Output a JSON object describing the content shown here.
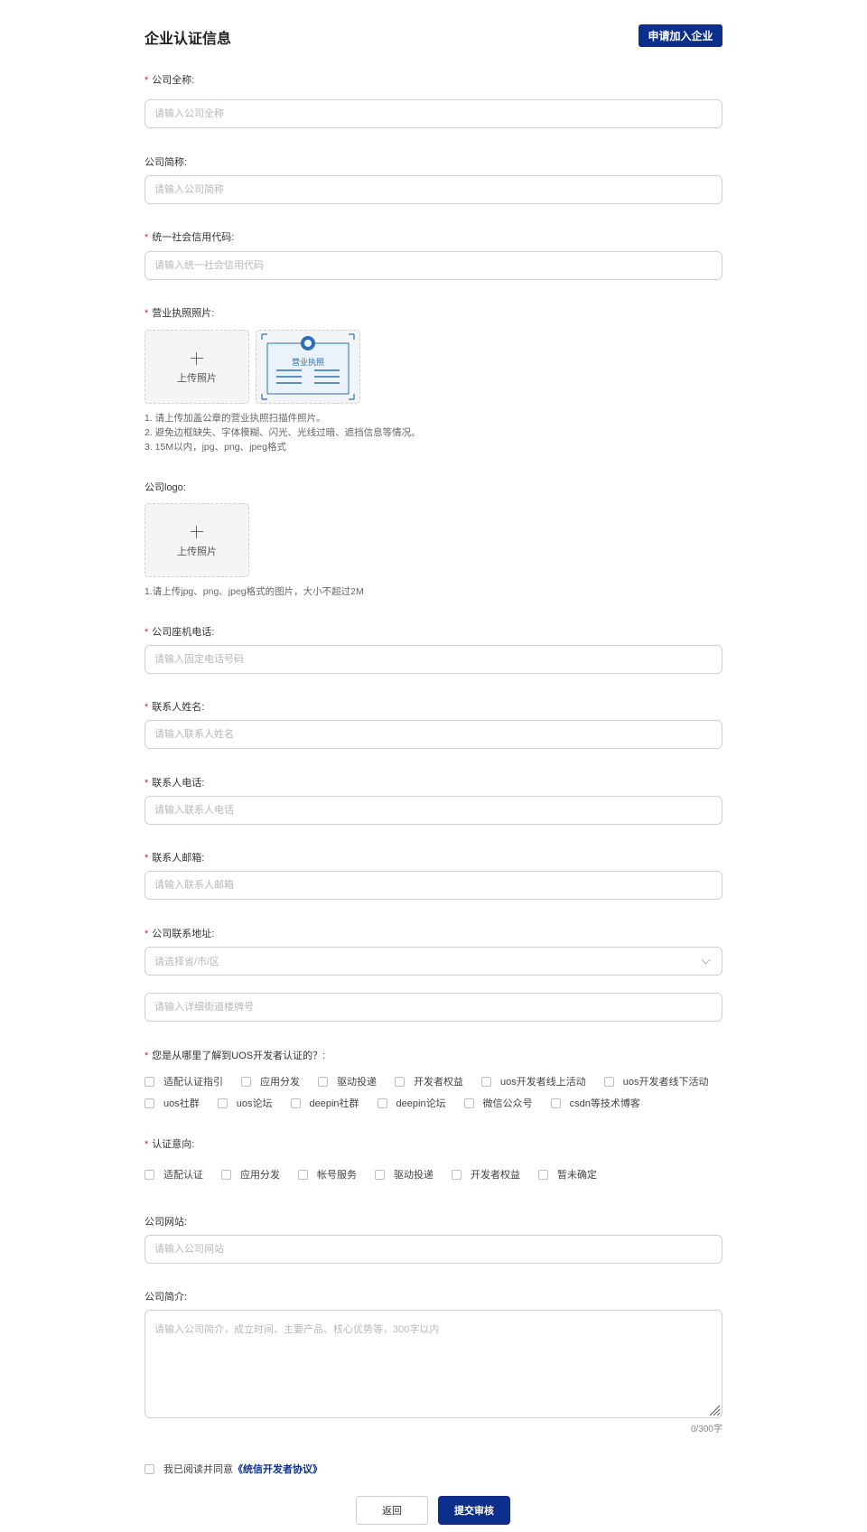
{
  "header": {
    "title": "企业认证信息",
    "join_button": "申请加入企业"
  },
  "fields": {
    "company_name": {
      "label": "公司全称:",
      "placeholder": "请输入公司全称",
      "required": "*"
    },
    "short_name": {
      "label": "公司简称:",
      "placeholder": "请输入公司简称"
    },
    "credit_code": {
      "label": "统一社会信用代码:",
      "placeholder": "请输入统一社会信用代码",
      "required": "*"
    },
    "license": {
      "label": "营业执照照片:",
      "required": "*",
      "upload_text": "上传照片",
      "sample_text": "营业执照",
      "hints": [
        "1. 请上传加盖公章的营业执照扫描件照片。",
        "2. 避免边框缺失、字体模糊、闪光、光线过暗、遮挡信息等情况。",
        "3. 15M以内，jpg、png、jpeg格式"
      ]
    },
    "logo": {
      "label": "公司logo:",
      "upload_text": "上传照片",
      "hint": "1.请上传jpg、png、jpeg格式的图片，大小不超过2M"
    },
    "landline": {
      "label": "公司座机电话:",
      "placeholder": "请输入固定电话号码",
      "required": "*"
    },
    "contact_name": {
      "label": "联系人姓名:",
      "placeholder": "请输入联系人姓名",
      "required": "*"
    },
    "contact_phone": {
      "label": "联系人电话:",
      "placeholder": "请输入联系人电话",
      "required": "*"
    },
    "contact_email": {
      "label": "联系人邮箱:",
      "placeholder": "请输入联系人邮箱",
      "required": "*"
    },
    "address": {
      "label": "公司联系地址:",
      "required": "*",
      "region_placeholder": "请选择省/市/区",
      "street_placeholder": "请输入详细街道楼牌号"
    },
    "source": {
      "label": "您是从哪里了解到UOS开发者认证的？:",
      "required": "*",
      "row1": [
        "适配认证指引",
        "应用分发",
        "驱动投递",
        "开发者权益",
        "uos开发者线上活动",
        "uos开发者线下活动"
      ],
      "row2": [
        "uos社群",
        "uos论坛",
        "deepin社群",
        "deepin论坛",
        "微信公众号",
        "csdn等技术博客"
      ]
    },
    "intent": {
      "label": "认证意向:",
      "required": "*",
      "options": [
        "适配认证",
        "应用分发",
        "帐号服务",
        "驱动投递",
        "开发者权益",
        "暂未确定"
      ]
    },
    "website": {
      "label": "公司网站:",
      "placeholder": "请输入公司网站"
    },
    "intro": {
      "label": "公司简介:",
      "placeholder": "请输入公司简介，成立时间、主要产品、核心优势等，300字以内",
      "counter": "0/300字"
    }
  },
  "agreement": {
    "text": "我已阅读并同意",
    "link": "《统信开发者协议》"
  },
  "actions": {
    "back": "返回",
    "submit": "提交审核"
  },
  "colors": {
    "primary": "#0b2f8a",
    "required": "#e02020"
  }
}
